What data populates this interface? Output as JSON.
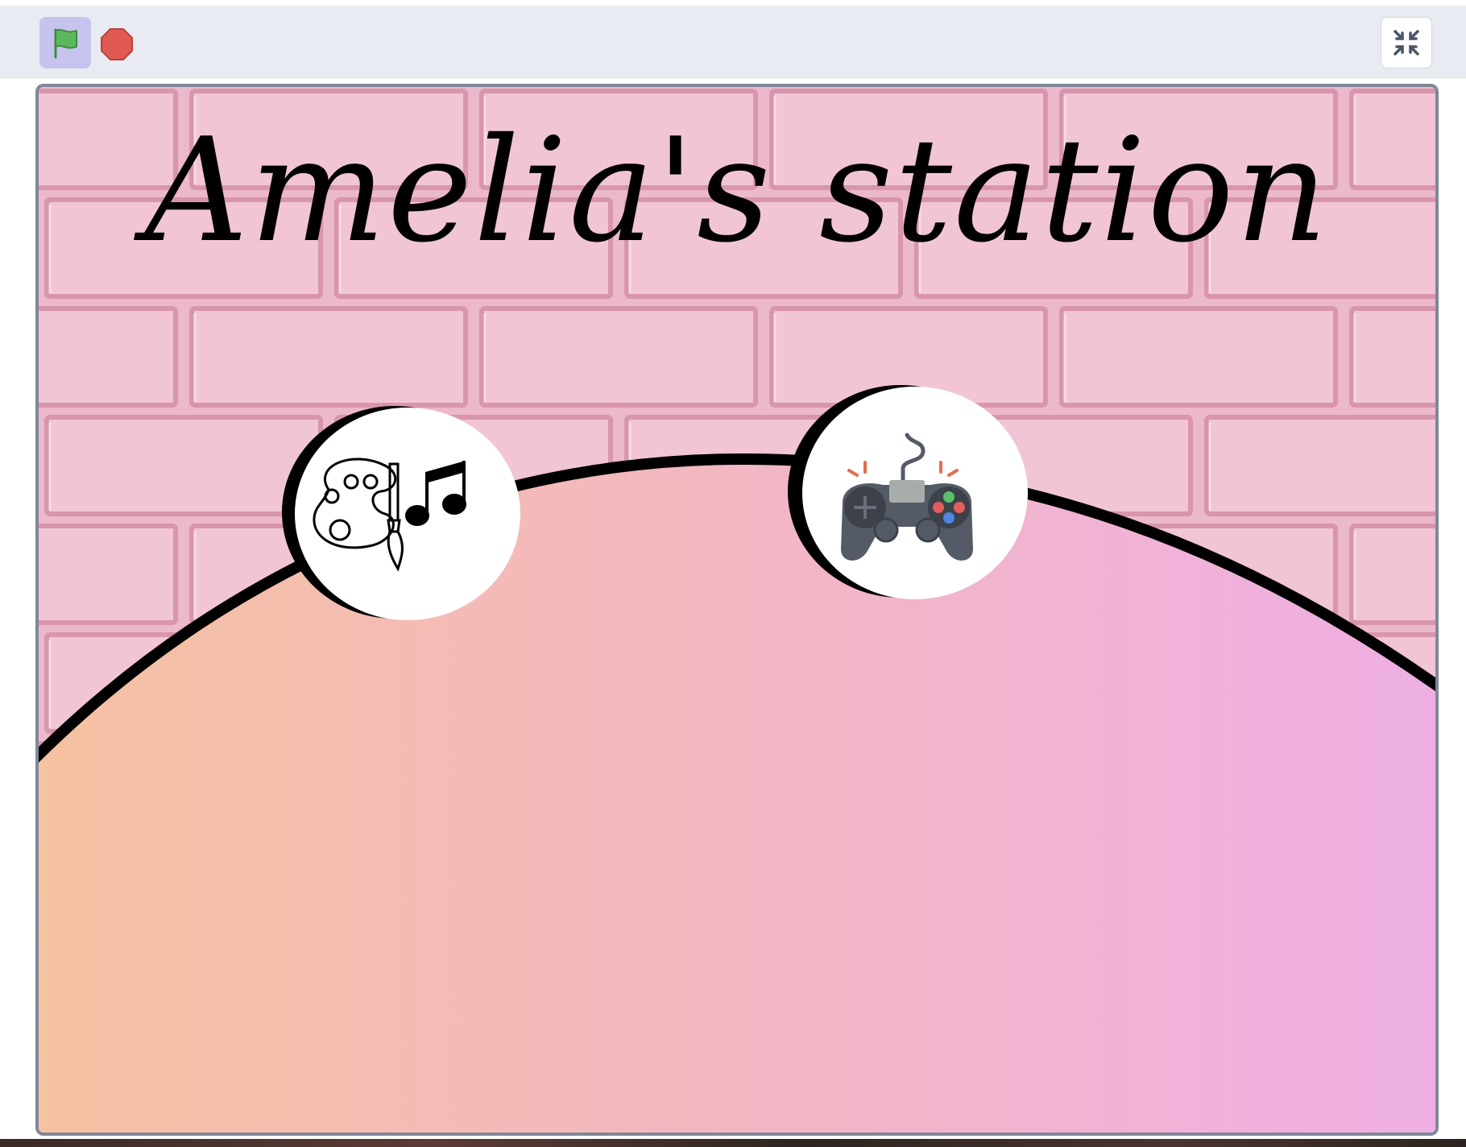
{
  "toolbar": {
    "green_flag": {
      "icon": "green-flag-icon",
      "color": "#5cb85c"
    },
    "stop": {
      "icon": "stop-sign-icon",
      "color": "#e05a52"
    },
    "fullscreen": {
      "icon": "exit-fullscreen-icon"
    }
  },
  "stage": {
    "title": "Amelia's station",
    "background": {
      "wall_color": "#ecb8cb",
      "gradient_left": "#f5c2a0",
      "gradient_right": "#eeaee6"
    },
    "sprites": [
      {
        "name": "art-music-sprite",
        "icons": [
          "palette-icon",
          "paintbrush-icon",
          "music-notes-icon"
        ]
      },
      {
        "name": "game-controller-sprite",
        "icons": [
          "game-controller-icon"
        ]
      }
    ]
  }
}
